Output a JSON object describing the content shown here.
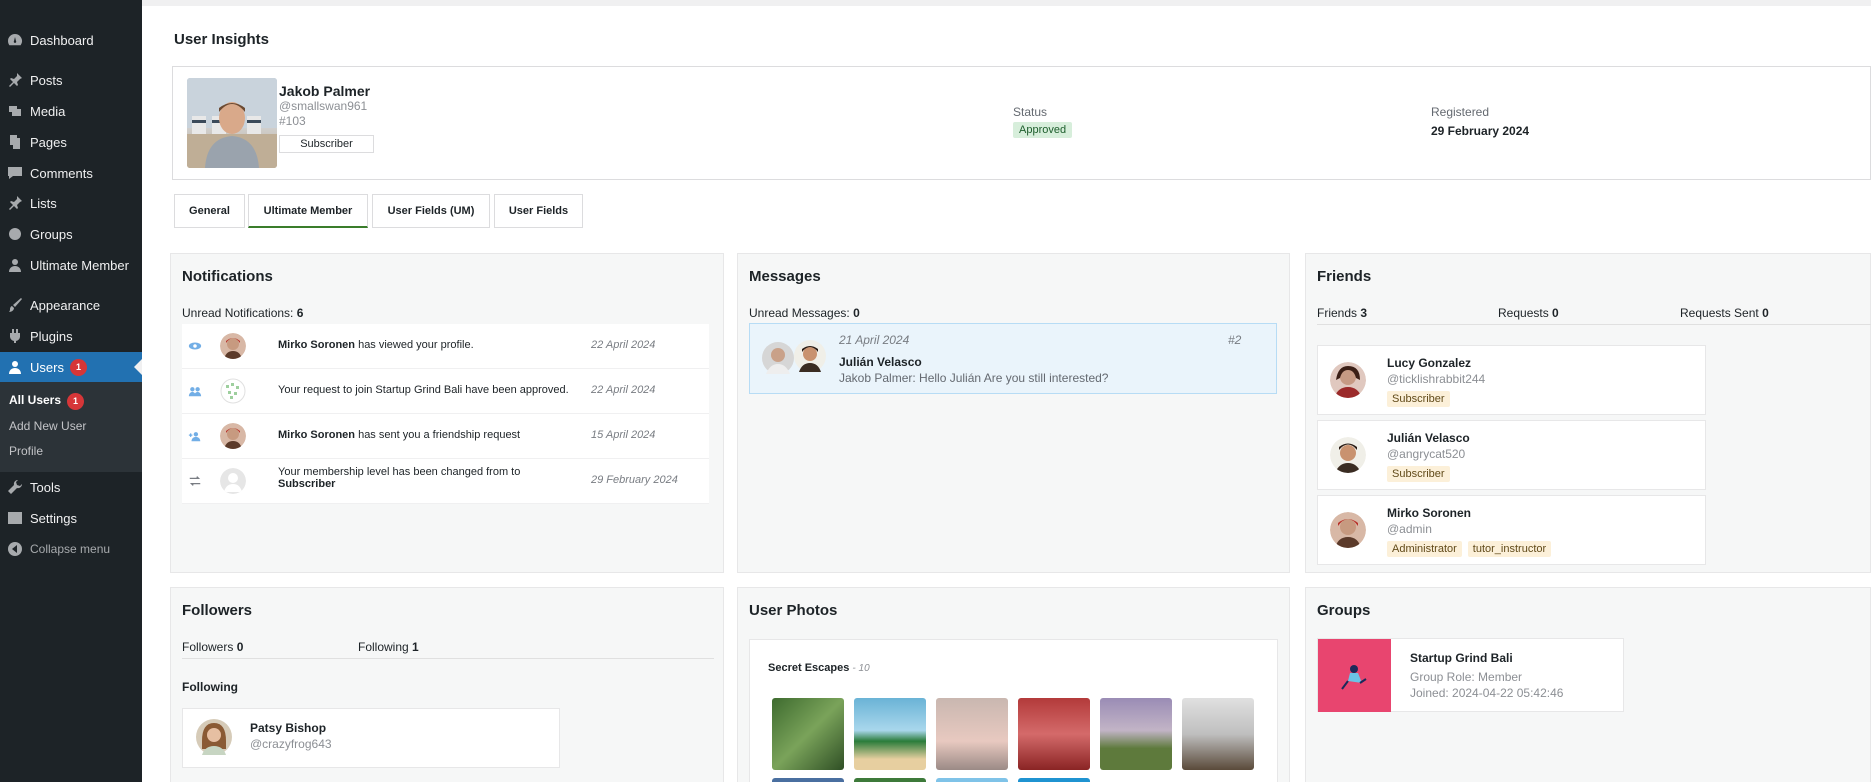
{
  "sidebar": {
    "items": [
      {
        "label": "Dashboard",
        "icon": "dashboard-icon"
      },
      {
        "label": "Posts",
        "icon": "pin-icon"
      },
      {
        "label": "Media",
        "icon": "media-icon"
      },
      {
        "label": "Pages",
        "icon": "pages-icon"
      },
      {
        "label": "Comments",
        "icon": "comments-icon"
      },
      {
        "label": "Lists",
        "icon": "pin-icon"
      },
      {
        "label": "Groups",
        "icon": "groups-icon"
      },
      {
        "label": "Ultimate Member",
        "icon": "user-icon"
      },
      {
        "label": "Appearance",
        "icon": "brush-icon"
      },
      {
        "label": "Plugins",
        "icon": "plug-icon"
      },
      {
        "label": "Users",
        "icon": "users-icon",
        "badge": "1"
      },
      {
        "label": "Tools",
        "icon": "wrench-icon"
      },
      {
        "label": "Settings",
        "icon": "settings-icon"
      },
      {
        "label": "Collapse menu",
        "icon": "collapse-icon"
      }
    ],
    "submenu": [
      {
        "label": "All Users",
        "badge": "1"
      },
      {
        "label": "Add New User"
      },
      {
        "label": "Profile"
      }
    ]
  },
  "page": {
    "title": "User Insights"
  },
  "profile": {
    "name": "Jakob Palmer",
    "username": "@smallswan961",
    "id": "#103",
    "role": "Subscriber",
    "status_label": "Status",
    "status": "Approved",
    "registered_label": "Registered",
    "registered": "29 February 2024"
  },
  "tabs": [
    "General",
    "Ultimate Member",
    "User Fields (UM)",
    "User Fields"
  ],
  "notifications": {
    "title": "Notifications",
    "unread_label": "Unread Notifications:",
    "unread_count": "6",
    "items": [
      {
        "bold": "Mirko Soronen",
        "text": " has viewed your profile.",
        "date": "22 April 2024"
      },
      {
        "bold": "",
        "text": "Your request to join Startup Grind Bali have been approved.",
        "date": "22 April 2024"
      },
      {
        "bold": "Mirko Soronen",
        "text": " has sent you a friendship request",
        "date": "15 April 2024"
      },
      {
        "bold": "",
        "text": "Your membership level has been changed from to",
        "text2": "Subscriber",
        "date": "29 February 2024"
      }
    ]
  },
  "messages": {
    "title": "Messages",
    "unread_label": "Unread Messages:",
    "unread_count": "0",
    "item": {
      "date": "21 April 2024",
      "num": "#2",
      "name": "Julián Velasco",
      "preview": "Jakob Palmer: Hello Julián Are you still interested?"
    }
  },
  "friends": {
    "title": "Friends",
    "friends_label": "Friends",
    "friends_count": "3",
    "requests_label": "Requests",
    "requests_count": "0",
    "sent_label": "Requests Sent",
    "sent_count": "0",
    "items": [
      {
        "name": "Lucy Gonzalez",
        "username": "@ticklishrabbit244",
        "tags": [
          "Subscriber"
        ]
      },
      {
        "name": "Julián Velasco",
        "username": "@angrycat520",
        "tags": [
          "Subscriber"
        ]
      },
      {
        "name": "Mirko Soronen",
        "username": "@admin",
        "tags": [
          "Administrator",
          "tutor_instructor"
        ]
      }
    ]
  },
  "followers": {
    "title": "Followers",
    "followers_label": "Followers",
    "followers_count": "0",
    "following_label": "Following",
    "following_count": "1",
    "following_heading": "Following",
    "item": {
      "name": "Patsy Bishop",
      "username": "@crazyfrog643"
    }
  },
  "photos": {
    "title": "User Photos",
    "album": "Secret Escapes",
    "album_count": "- 10"
  },
  "groups": {
    "title": "Groups",
    "item": {
      "name": "Startup Grind Bali",
      "role": "Group Role: Member",
      "joined": "Joined: 2024-04-22 05:42:46"
    }
  }
}
